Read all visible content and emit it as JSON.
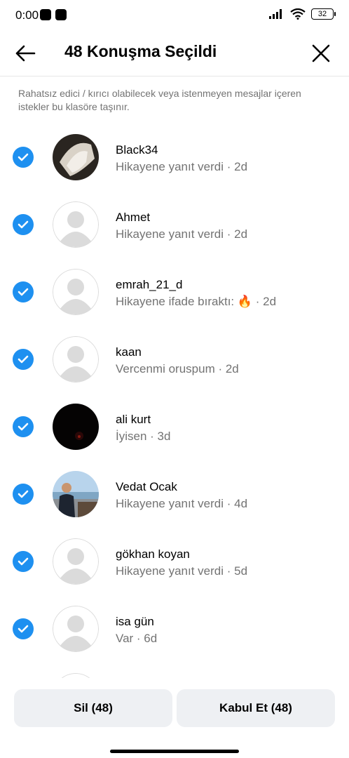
{
  "status": {
    "time": "0:00",
    "battery": "32"
  },
  "header": {
    "title": "48 Konuşma Seçildi"
  },
  "info_text": "Rahatsız edici / kırıcı olabilecek veya istenmeyen mesajlar içeren istekler bu klasöre taşınır.",
  "requests": [
    {
      "name": "Black34",
      "subtitle": "Hikayene yanıt verdi · 2d",
      "avatar": "photo-dark"
    },
    {
      "name": "Ahmet",
      "subtitle": "Hikayene yanıt verdi · 2d",
      "avatar": "default"
    },
    {
      "name": "emrah_21_d",
      "subtitle": "Hikayene ifade bıraktı: 🔥 · 2d",
      "avatar": "default"
    },
    {
      "name": "kaan",
      "subtitle": "Vercenmi oruspum · 2d",
      "avatar": "default"
    },
    {
      "name": "ali kurt",
      "subtitle": "İyisen · 3d",
      "avatar": "photo-black"
    },
    {
      "name": "Vedat Ocak",
      "subtitle": "Hikayene yanıt verdi · 4d",
      "avatar": "photo-outdoor"
    },
    {
      "name": "gökhan koyan",
      "subtitle": "Hikayene yanıt verdi · 5d",
      "avatar": "default"
    },
    {
      "name": "isa gün",
      "subtitle": "Var · 6d",
      "avatar": "default"
    }
  ],
  "actions": {
    "delete_label": "Sil (48)",
    "accept_label": "Kabul Et (48)"
  },
  "colors": {
    "accent": "#1e90f0",
    "secondary_text": "#737373",
    "button_bg": "#eef0f3"
  }
}
